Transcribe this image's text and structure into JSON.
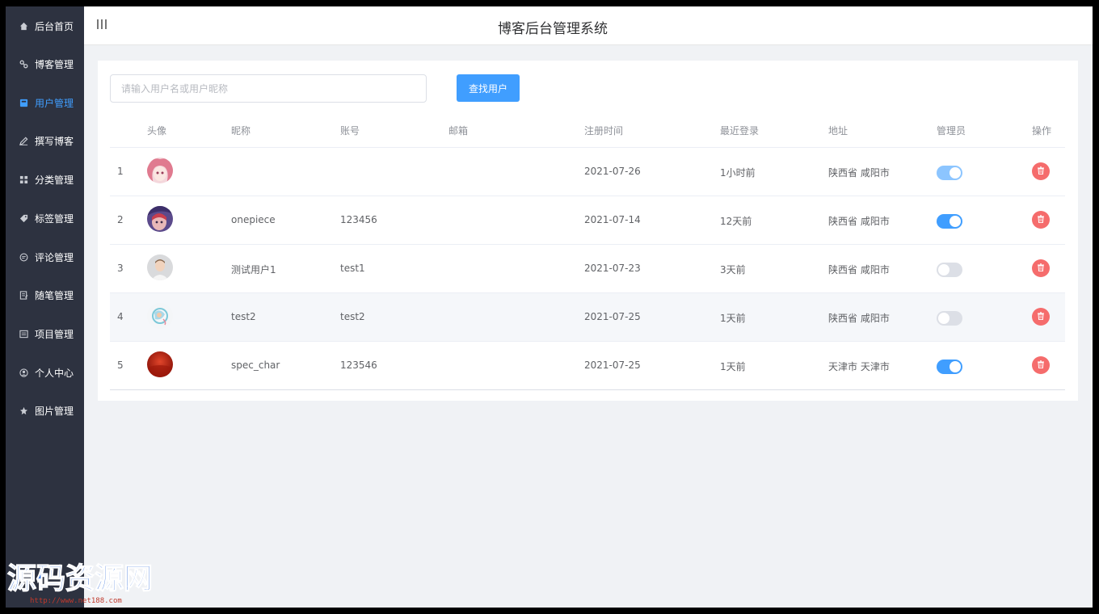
{
  "header": {
    "title": "博客后台管理系统"
  },
  "sidebar": {
    "items": [
      {
        "label": "后台首页",
        "icon": "home-icon"
      },
      {
        "label": "博客管理",
        "icon": "blog-icon"
      },
      {
        "label": "用户管理",
        "icon": "user-icon",
        "active": true
      },
      {
        "label": "撰写博客",
        "icon": "edit-icon"
      },
      {
        "label": "分类管理",
        "icon": "grid-icon"
      },
      {
        "label": "标签管理",
        "icon": "tag-icon"
      },
      {
        "label": "评论管理",
        "icon": "comment-icon"
      },
      {
        "label": "随笔管理",
        "icon": "note-icon"
      },
      {
        "label": "项目管理",
        "icon": "project-icon"
      },
      {
        "label": "个人中心",
        "icon": "profile-icon"
      },
      {
        "label": "图片管理",
        "icon": "image-icon"
      }
    ]
  },
  "search": {
    "placeholder": "请输入用户名或用户昵称",
    "value": "",
    "button_label": "查找用户"
  },
  "table": {
    "columns": [
      "头像",
      "昵称",
      "账号",
      "邮箱",
      "注册时间",
      "最近登录",
      "地址",
      "管理员",
      "操作"
    ],
    "rows": [
      {
        "index": "1",
        "nickname": "",
        "account": "",
        "email": "",
        "registered": "2021-07-26",
        "last_login": "1小时前",
        "address": "陕西省 咸阳市",
        "admin": true
      },
      {
        "index": "2",
        "nickname": "onepiece",
        "account": "123456",
        "email": "",
        "registered": "2021-07-14",
        "last_login": "12天前",
        "address": "陕西省 咸阳市",
        "admin": true
      },
      {
        "index": "3",
        "nickname": "测试用户1",
        "account": "test1",
        "email": "",
        "registered": "2021-07-23",
        "last_login": "3天前",
        "address": "陕西省 咸阳市",
        "admin": false
      },
      {
        "index": "4",
        "nickname": "test2",
        "account": "test2",
        "email": "",
        "registered": "2021-07-25",
        "last_login": "1天前",
        "address": "陕西省 咸阳市",
        "admin": false
      },
      {
        "index": "5",
        "nickname": "spec_char",
        "account": "123546",
        "email": "",
        "registered": "2021-07-25",
        "last_login": "1天前",
        "address": "天津市 天津市",
        "admin": true
      }
    ]
  },
  "watermark": {
    "text": "源码资源网",
    "url": "http://www.net188.com"
  },
  "colors": {
    "primary": "#409eff",
    "danger": "#f56c6c",
    "sidebar_bg": "#2d3240"
  }
}
